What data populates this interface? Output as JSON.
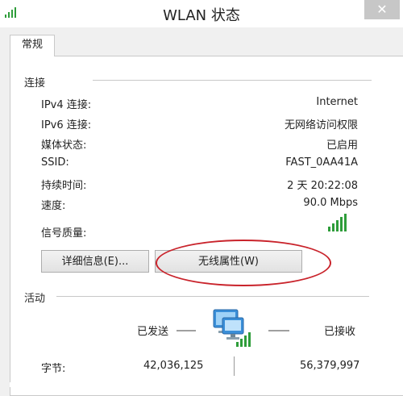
{
  "window": {
    "title": "WLAN 状态",
    "close_glyph": "✕"
  },
  "tabs": [
    {
      "label": "常规"
    }
  ],
  "connection": {
    "section_label": "连接",
    "rows": [
      {
        "label": "IPv4 连接:",
        "value": "Internet"
      },
      {
        "label": "IPv6 连接:",
        "value": "无网络访问权限"
      },
      {
        "label": "媒体状态:",
        "value": "已启用"
      },
      {
        "label": "SSID:",
        "value": "FAST_0AA41A"
      },
      {
        "label": "持续时间:",
        "value": "2 天 20:22:08"
      },
      {
        "label": "速度:",
        "value": "90.0 Mbps"
      }
    ],
    "signal_label": "信号质量:",
    "signal_level": 5,
    "signal_max": 5,
    "signal_color": "#2e9d3a"
  },
  "buttons": {
    "details": "详细信息(E)...",
    "wireless_properties": "无线属性(W)"
  },
  "highlight": {
    "color": "#c9232b"
  },
  "activity": {
    "section_label": "活动",
    "sent_label": "已发送",
    "received_label": "已接收",
    "bytes_label": "字节:",
    "bytes_sent": "42,036,125",
    "bytes_received": "56,379,997",
    "icon": "network-computer-icon"
  }
}
